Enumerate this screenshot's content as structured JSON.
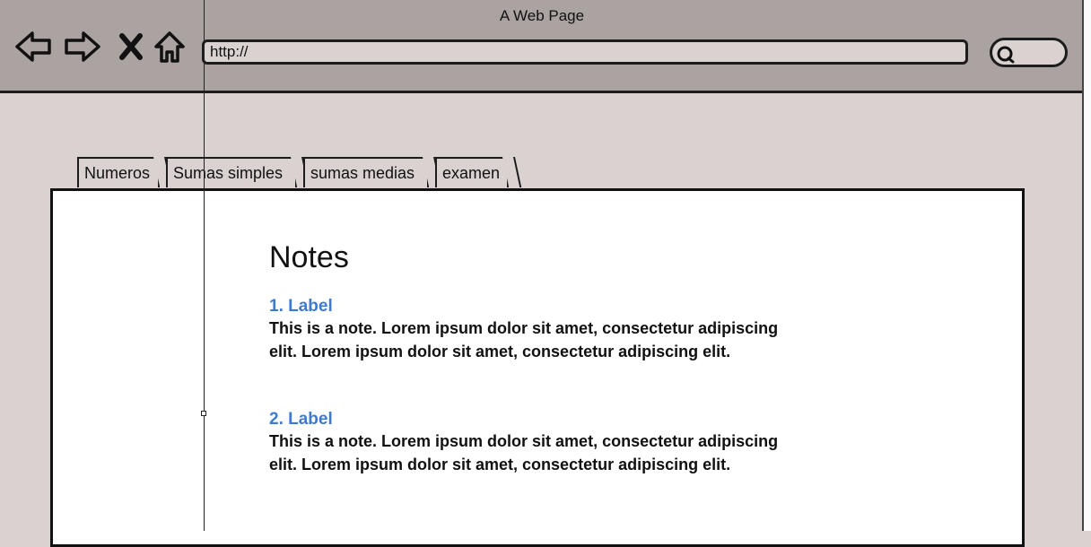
{
  "window": {
    "title": "A Web Page"
  },
  "navigation": {
    "back_icon": "back-arrow-icon",
    "forward_icon": "forward-arrow-icon",
    "stop_icon": "close-icon",
    "home_icon": "home-icon"
  },
  "address_bar": {
    "value": "http://"
  },
  "search": {
    "icon": "search-icon"
  },
  "tabs": [
    {
      "label": "Numeros"
    },
    {
      "label": "Sumas simples"
    },
    {
      "label": "sumas medias"
    },
    {
      "label": "examen"
    }
  ],
  "content": {
    "title": "Notes",
    "notes": [
      {
        "label": "1. Label",
        "text": "This is a note. Lorem ipsum dolor sit amet, consectetur adipiscing elit. Lorem ipsum dolor sit amet, consectetur adipiscing elit."
      },
      {
        "label": "2. Label",
        "text": "This is a note. Lorem ipsum dolor sit amet, consectetur adipiscing elit. Lorem ipsum dolor sit amet, consectetur adipiscing elit."
      }
    ]
  },
  "colors": {
    "chrome": "#aba3a1",
    "background": "#dad2d1",
    "label": "#3d7bd1"
  }
}
